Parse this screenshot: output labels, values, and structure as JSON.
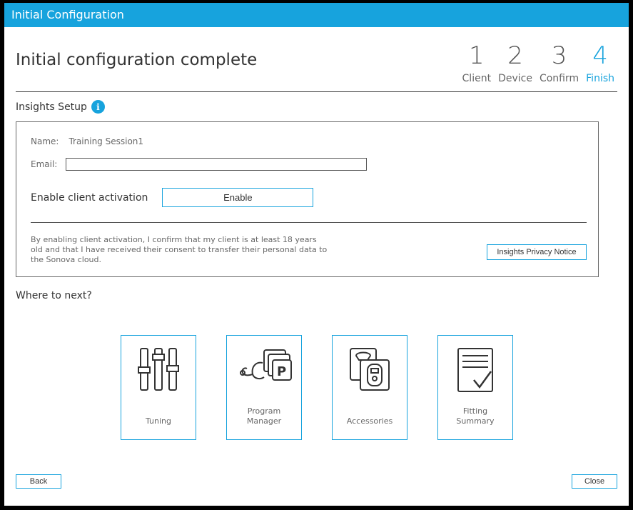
{
  "window": {
    "title": "Initial Configuration"
  },
  "header": {
    "page_title": "Initial configuration complete",
    "steps": [
      {
        "num": "1",
        "label": "Client"
      },
      {
        "num": "2",
        "label": "Device"
      },
      {
        "num": "3",
        "label": "Confirm"
      },
      {
        "num": "4",
        "label": "Finish"
      }
    ],
    "active_step": 4
  },
  "insights": {
    "section_title": "Insights Setup",
    "name_label": "Name:",
    "name_value": "Training Session1",
    "email_label": "Email:",
    "email_value": "",
    "enable_label": "Enable client activation",
    "enable_button": "Enable",
    "consent_text": "By enabling client activation, I confirm that my client is at least 18 years old and that I have received their consent to transfer their personal data to the Sonova cloud.",
    "privacy_button": "Insights Privacy Notice"
  },
  "next": {
    "title": "Where to next?",
    "tiles": [
      {
        "label": "Tuning",
        "icon": "sliders-icon"
      },
      {
        "label": "Program Manager",
        "icon": "program-manager-icon"
      },
      {
        "label": "Accessories",
        "icon": "accessories-icon"
      },
      {
        "label": "Fitting Summary",
        "icon": "fitting-summary-icon"
      }
    ]
  },
  "footer": {
    "back_button": "Back",
    "close_button": "Close"
  },
  "colors": {
    "accent": "#17a3dd",
    "text": "#333333",
    "muted": "#666666"
  }
}
